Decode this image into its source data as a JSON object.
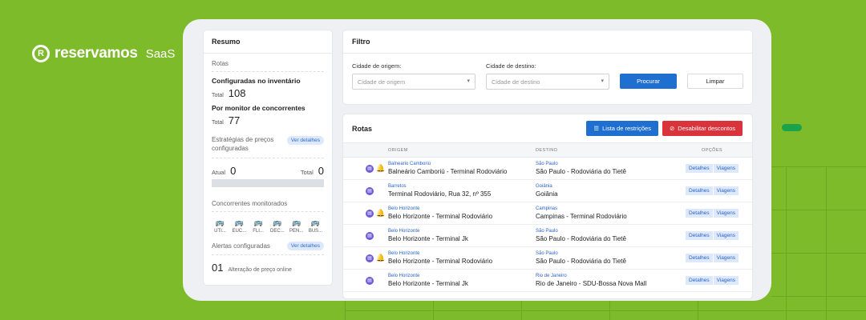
{
  "brand": {
    "name": "reservamos",
    "suffix": "SaaS",
    "accent": "#7dbb2a"
  },
  "summary": {
    "title": "Resumo",
    "rotas_label": "Rotas",
    "inventory": {
      "label": "Configuradas no inventário",
      "total_label": "Total",
      "total": "108"
    },
    "competitors_monitor": {
      "label": "Por monitor de concorrentes",
      "total_label": "Total",
      "total": "77"
    },
    "strategies": {
      "label": "Estratégias de preços configuradas",
      "badge": "Ver detalhes"
    },
    "atual": {
      "label": "Atual",
      "value": "0",
      "total_label": "Total",
      "total": "0"
    },
    "competitors": {
      "label": "Concorrentes monitorados",
      "items": [
        {
          "icon": "bus-icon",
          "name": "UTI..."
        },
        {
          "icon": "bus-icon",
          "name": "EUC..."
        },
        {
          "icon": "bus-icon",
          "name": "FLI..."
        },
        {
          "icon": "bus-icon",
          "name": "DEC..."
        },
        {
          "icon": "bus-icon",
          "name": "PEN..."
        },
        {
          "icon": "bus-icon",
          "name": "BUS..."
        }
      ]
    },
    "alerts": {
      "label": "Alertas configuradas",
      "badge": "Ver detalhes",
      "count": "01",
      "desc": "Alteração de preço online"
    }
  },
  "filter": {
    "title": "Filtro",
    "origin_label": "Cidade de origem:",
    "origin_placeholder": "Cidade de origem",
    "dest_label": "Cidade de destino:",
    "dest_placeholder": "Cidade de destino",
    "search_button": "Procurar",
    "clear_button": "Limpar"
  },
  "routes": {
    "title": "Rotas",
    "restrictions_button": "Lista de restrições",
    "disable_button": "Desabilitar descontos",
    "columns": [
      "ORIGEM",
      "DESTINO",
      "OPÇÕES"
    ],
    "options": [
      "Detalhes",
      "Viagens"
    ],
    "rows": [
      {
        "bell": true,
        "origin_city": "Balneario Camboriú",
        "origin_terminal": "Balneário Camboriú - Terminal Rodoviário",
        "dest_city": "São Paulo",
        "dest_terminal": "São Paulo - Rodoviária do Tietê"
      },
      {
        "bell": false,
        "origin_city": "Barretos",
        "origin_terminal": "Terminal Rodoviário, Rua 32, nº 355",
        "dest_city": "Goiânia",
        "dest_terminal": "Goiânia"
      },
      {
        "bell": true,
        "origin_city": "Belo Horizonte",
        "origin_terminal": "Belo Horizonte - Terminal Rodoviário",
        "dest_city": "Campinas",
        "dest_terminal": "Campinas - Terminal Rodoviário"
      },
      {
        "bell": false,
        "origin_city": "Belo Horizonte",
        "origin_terminal": "Belo Horizonte - Terminal Jk",
        "dest_city": "São Paulo",
        "dest_terminal": "São Paulo - Rodoviária do Tietê"
      },
      {
        "bell": true,
        "origin_city": "Belo Horizonte",
        "origin_terminal": "Belo Horizonte - Terminal Rodoviário",
        "dest_city": "São Paulo",
        "dest_terminal": "São Paulo - Rodoviária do Tietê"
      },
      {
        "bell": false,
        "origin_city": "Belo Horizonte",
        "origin_terminal": "Belo Horizonte - Terminal Jk",
        "dest_city": "Rio de Janeiro",
        "dest_terminal": "Rio de Janeiro - SDU-Bossa Nova Mall"
      }
    ]
  }
}
